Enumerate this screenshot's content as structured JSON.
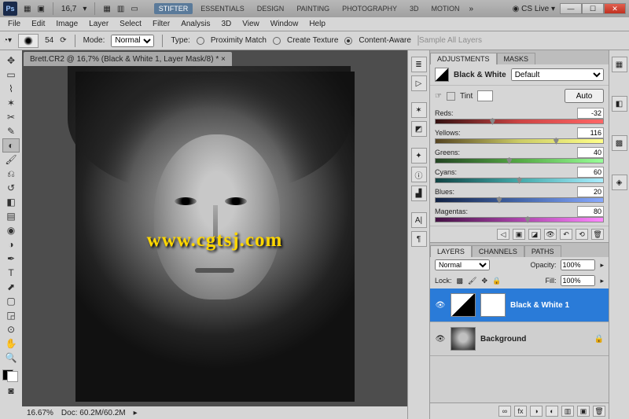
{
  "app": {
    "logo": "Ps",
    "zoom_field": "16,7",
    "cs_live": "CS Live"
  },
  "workspaces": [
    "STIFTER",
    "ESSENTIALS",
    "DESIGN",
    "PAINTING",
    "PHOTOGRAPHY",
    "3D",
    "MOTION"
  ],
  "workspace_active": 0,
  "menu": [
    "File",
    "Edit",
    "Image",
    "Layer",
    "Select",
    "Filter",
    "Analysis",
    "3D",
    "View",
    "Window",
    "Help"
  ],
  "options": {
    "brush_size": "54",
    "mode_label": "Mode:",
    "mode_value": "Normal",
    "type_label": "Type:",
    "r1": "Proximity Match",
    "r2": "Create Texture",
    "r3": "Content-Aware",
    "sample_all": "Sample All Layers"
  },
  "document": {
    "tab": "Brett.CR2 @ 16,7% (Black & White 1, Layer Mask/8) *",
    "zoom_status": "16.67%",
    "doc_status": "Doc: 60.2M/60.2M"
  },
  "watermark": "www.cgtsj.com",
  "adjustments": {
    "tab1": "ADJUSTMENTS",
    "tab2": "MASKS",
    "title": "Black & White",
    "preset": "Default",
    "tint_label": "Tint",
    "auto": "Auto",
    "sliders": [
      {
        "label": "Reds:",
        "value": "-32",
        "trackClass": "t-reds",
        "pos": 34
      },
      {
        "label": "Yellows:",
        "value": "116",
        "trackClass": "t-yellows",
        "pos": 72
      },
      {
        "label": "Greens:",
        "value": "40",
        "trackClass": "t-greens",
        "pos": 44
      },
      {
        "label": "Cyans:",
        "value": "60",
        "trackClass": "t-cyans",
        "pos": 50
      },
      {
        "label": "Blues:",
        "value": "20",
        "trackClass": "t-blues",
        "pos": 38
      },
      {
        "label": "Magentas:",
        "value": "80",
        "trackClass": "t-magentas",
        "pos": 55
      }
    ]
  },
  "layers": {
    "tab1": "LAYERS",
    "tab2": "CHANNELS",
    "tab3": "PATHS",
    "blend": "Normal",
    "opacity_label": "Opacity:",
    "opacity": "100%",
    "lock_label": "Lock:",
    "fill_label": "Fill:",
    "fill": "100%",
    "items": [
      {
        "name": "Black & White 1",
        "selected": true,
        "type": "adj"
      },
      {
        "name": "Background",
        "selected": false,
        "type": "img"
      }
    ]
  }
}
